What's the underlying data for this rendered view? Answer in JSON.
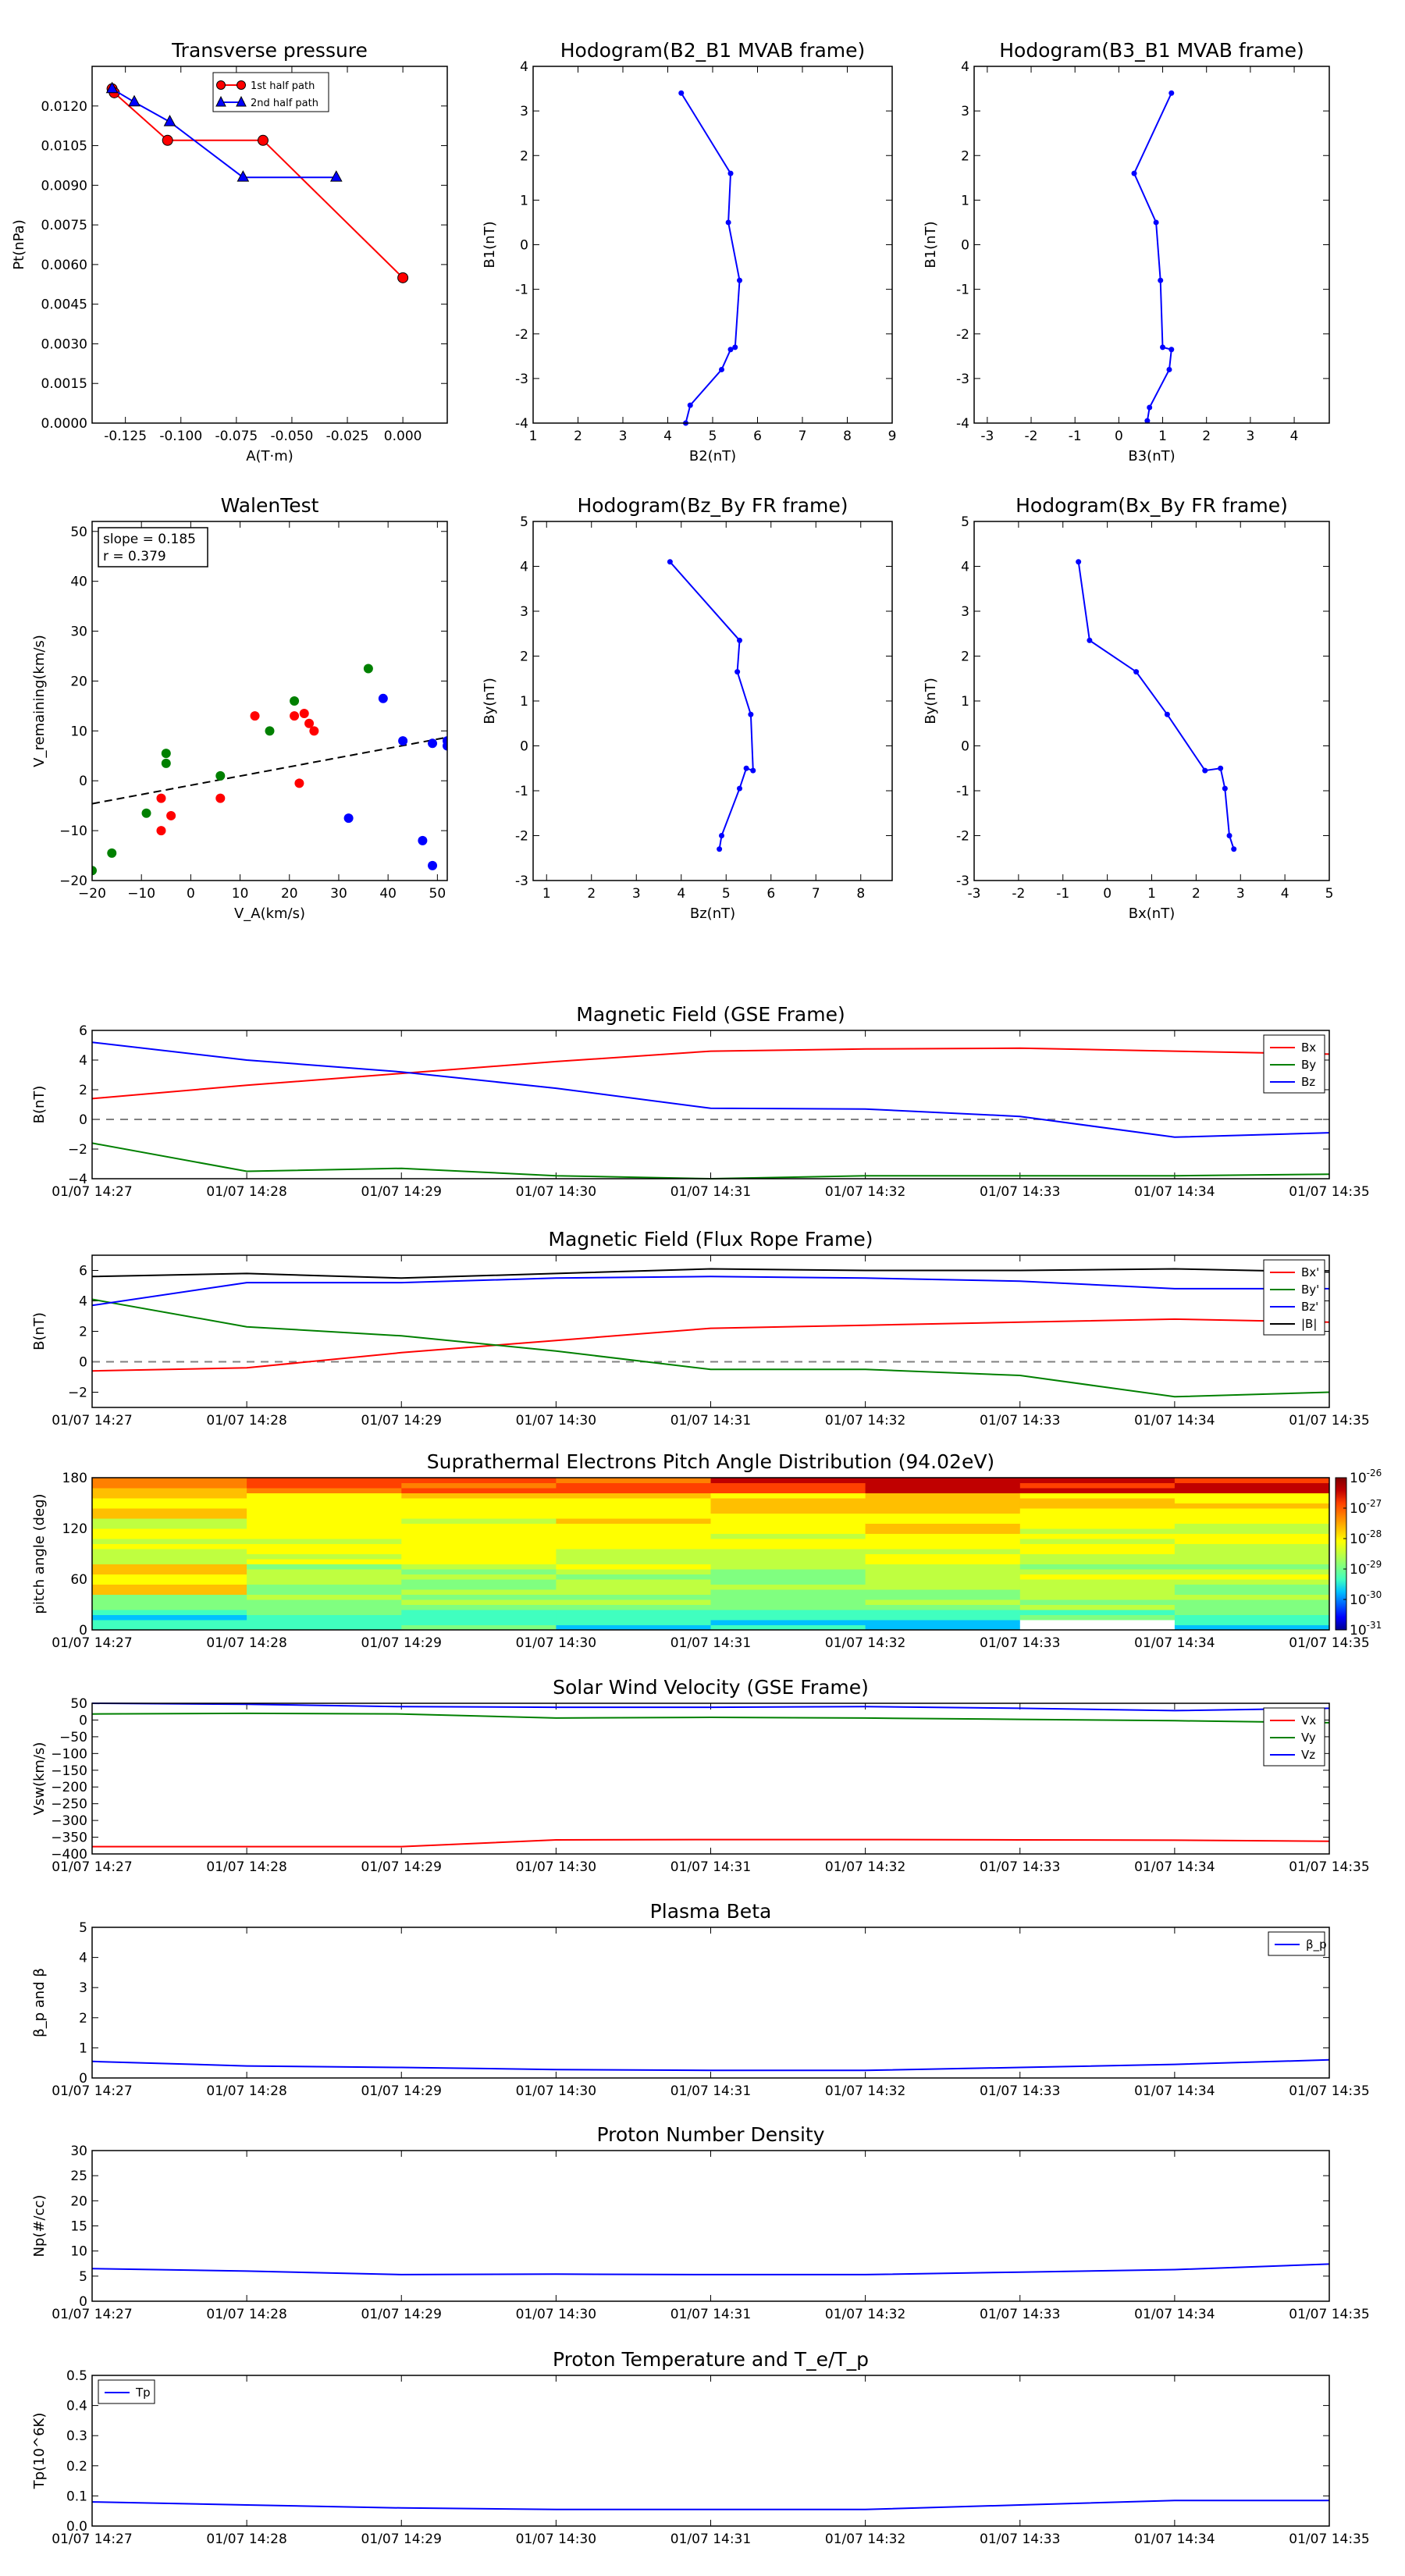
{
  "colors": {
    "red": "#ff0000",
    "green": "#008000",
    "blue": "#0000ff",
    "black": "#000000",
    "dash": "#808080"
  },
  "time_ticks": [
    "01/07 14:27",
    "01/07 14:28",
    "01/07 14:29",
    "01/07 14:30",
    "01/07 14:31",
    "01/07 14:32",
    "01/07 14:33",
    "01/07 14:34",
    "01/07 14:35"
  ],
  "colorbar_ticks": [
    "10",
    "10",
    "10",
    "10",
    "10",
    "10"
  ],
  "colorbar_exps": [
    "-26",
    "-27",
    "-28",
    "-29",
    "-30",
    "-31"
  ],
  "chart_data": [
    {
      "type": "line",
      "title": "Transverse pressure",
      "xlabel": "A(T·m)",
      "ylabel": "Pt(nPa)",
      "xlim": [
        -0.14,
        0.02
      ],
      "ylim": [
        0,
        0.0135
      ],
      "xticks": [
        "-0.125",
        "-0.100",
        "-0.075",
        "-0.050",
        "-0.025",
        "0.000"
      ],
      "xtick_vals": [
        -0.125,
        -0.1,
        -0.075,
        -0.05,
        -0.025,
        0.0
      ],
      "yticks": [
        "0.0000",
        "0.0015",
        "0.0030",
        "0.0045",
        "0.0060",
        "0.0075",
        "0.0090",
        "0.0105",
        "0.0120"
      ],
      "ytick_vals": [
        0,
        0.0015,
        0.003,
        0.0045,
        0.006,
        0.0075,
        0.009,
        0.0105,
        0.012
      ],
      "legend": "upper center",
      "series": [
        {
          "name": "1st half path",
          "color": "red",
          "marker": "circle",
          "x": [
            -0.131,
            -0.13,
            -0.106,
            -0.063,
            0.0
          ],
          "y": [
            0.01265,
            0.0125,
            0.0107,
            0.0107,
            0.0055
          ]
        },
        {
          "name": "2nd half path",
          "color": "blue",
          "marker": "triangle",
          "x": [
            -0.131,
            -0.121,
            -0.105,
            -0.072,
            -0.03
          ],
          "y": [
            0.01265,
            0.01215,
            0.0114,
            0.0093,
            0.0093
          ]
        }
      ]
    },
    {
      "type": "line",
      "title": "Hodogram(B2_B1 MVAB frame)",
      "xlabel": "B2(nT)",
      "ylabel": "B1(nT)",
      "xlim": [
        1,
        9
      ],
      "ylim": [
        -4,
        4
      ],
      "xticks": [
        "1",
        "2",
        "3",
        "4",
        "5",
        "6",
        "7",
        "8",
        "9"
      ],
      "xtick_vals": [
        1,
        2,
        3,
        4,
        5,
        6,
        7,
        8,
        9
      ],
      "yticks": [
        "-4",
        "-3",
        "-2",
        "-1",
        "0",
        "1",
        "2",
        "3",
        "4"
      ],
      "ytick_vals": [
        -4,
        -3,
        -2,
        -1,
        0,
        1,
        2,
        3,
        4
      ],
      "series": [
        {
          "color": "blue",
          "marker": "dot",
          "x": [
            4.3,
            5.4,
            5.35,
            5.6,
            5.5,
            5.4,
            5.2,
            4.5,
            4.4
          ],
          "y": [
            3.4,
            1.6,
            0.5,
            -0.8,
            -2.3,
            -2.35,
            -2.8,
            -3.6,
            -4.0
          ]
        }
      ]
    },
    {
      "type": "line",
      "title": "Hodogram(B3_B1 MVAB frame)",
      "xlabel": "B3(nT)",
      "ylabel": "B1(nT)",
      "xlim": [
        -3.3,
        4.8
      ],
      "ylim": [
        -4,
        4
      ],
      "xticks": [
        "-3",
        "-2",
        "-1",
        "0",
        "1",
        "2",
        "3",
        "4"
      ],
      "xtick_vals": [
        -3,
        -2,
        -1,
        0,
        1,
        2,
        3,
        4
      ],
      "yticks": [
        "-4",
        "-3",
        "-2",
        "-1",
        "0",
        "1",
        "2",
        "3",
        "4"
      ],
      "ytick_vals": [
        -4,
        -3,
        -2,
        -1,
        0,
        1,
        2,
        3,
        4
      ],
      "series": [
        {
          "color": "blue",
          "marker": "dot",
          "x": [
            1.2,
            0.35,
            0.85,
            0.95,
            1.0,
            1.2,
            1.15,
            0.7,
            0.65
          ],
          "y": [
            3.4,
            1.6,
            0.5,
            -0.8,
            -2.3,
            -2.35,
            -2.8,
            -3.65,
            -3.95
          ]
        }
      ]
    },
    {
      "type": "scatter",
      "title": "WalenTest",
      "xlabel": "V_A(km/s)",
      "ylabel": "V_remaining(km/s)",
      "xlim": [
        -20,
        52
      ],
      "ylim": [
        -20,
        52
      ],
      "xticks": [
        "−20",
        "−10",
        "0",
        "10",
        "20",
        "30",
        "40",
        "50"
      ],
      "xtick_vals": [
        -20,
        -10,
        0,
        10,
        20,
        30,
        40,
        50
      ],
      "yticks": [
        "−20",
        "−10",
        "0",
        "10",
        "20",
        "30",
        "40",
        "50"
      ],
      "ytick_vals": [
        -20,
        -10,
        0,
        10,
        20,
        30,
        40,
        50
      ],
      "annotation": [
        "slope = 0.185",
        "r = 0.379"
      ],
      "fit_line": {
        "slope": 0.185,
        "intercept": -0.9
      },
      "series": [
        {
          "color": "red",
          "x": [
            13,
            21,
            23,
            24,
            25,
            22,
            -6,
            -4,
            6,
            -6
          ],
          "y": [
            13,
            13,
            13.5,
            11.5,
            10,
            -0.5,
            -3.5,
            -7,
            -3.5,
            -10
          ]
        },
        {
          "color": "green",
          "x": [
            -5,
            -5,
            6,
            16,
            21,
            36,
            -9,
            -16,
            -20
          ],
          "y": [
            5.5,
            3.5,
            1,
            10,
            16,
            22.5,
            -6.5,
            -14.5,
            -18
          ]
        },
        {
          "color": "blue",
          "x": [
            39,
            43,
            49,
            52,
            52,
            32,
            47,
            49
          ],
          "y": [
            16.5,
            8,
            7.5,
            8,
            7,
            -7.5,
            -12,
            -17
          ]
        }
      ]
    },
    {
      "type": "line",
      "title": "Hodogram(Bz_By FR frame)",
      "xlabel": "Bz(nT)",
      "ylabel": "By(nT)",
      "xlim": [
        0.7,
        8.7
      ],
      "ylim": [
        -3,
        5
      ],
      "xticks": [
        "1",
        "2",
        "3",
        "4",
        "5",
        "6",
        "7",
        "8"
      ],
      "xtick_vals": [
        1,
        2,
        3,
        4,
        5,
        6,
        7,
        8
      ],
      "yticks": [
        "-3",
        "-2",
        "-1",
        "0",
        "1",
        "2",
        "3",
        "4",
        "5"
      ],
      "ytick_vals": [
        -3,
        -2,
        -1,
        0,
        1,
        2,
        3,
        4,
        5
      ],
      "series": [
        {
          "color": "blue",
          "marker": "dot",
          "x": [
            3.75,
            5.3,
            5.25,
            5.55,
            5.6,
            5.45,
            5.3,
            4.9,
            4.85
          ],
          "y": [
            4.1,
            2.35,
            1.65,
            0.7,
            -0.55,
            -0.5,
            -0.95,
            -2.0,
            -2.3
          ]
        }
      ]
    },
    {
      "type": "line",
      "title": "Hodogram(Bx_By FR frame)",
      "xlabel": "Bx(nT)",
      "ylabel": "By(nT)",
      "xlim": [
        -3,
        5
      ],
      "ylim": [
        -3,
        5
      ],
      "xticks": [
        "-3",
        "-2",
        "-1",
        "0",
        "1",
        "2",
        "3",
        "4",
        "5"
      ],
      "xtick_vals": [
        -3,
        -2,
        -1,
        0,
        1,
        2,
        3,
        4,
        5
      ],
      "yticks": [
        "-3",
        "-2",
        "-1",
        "0",
        "1",
        "2",
        "3",
        "4",
        "5"
      ],
      "ytick_vals": [
        -3,
        -2,
        -1,
        0,
        1,
        2,
        3,
        4,
        5
      ],
      "series": [
        {
          "color": "blue",
          "marker": "dot",
          "x": [
            -0.65,
            -0.4,
            0.65,
            1.35,
            2.2,
            2.55,
            2.65,
            2.75,
            2.85
          ],
          "y": [
            4.1,
            2.35,
            1.65,
            0.7,
            -0.55,
            -0.5,
            -0.95,
            -2.0,
            -2.3
          ]
        }
      ]
    },
    {
      "type": "line",
      "title": "Magnetic Field (GSE Frame)",
      "xlabel": "",
      "ylabel": "B(nT)",
      "ylim": [
        -4,
        6
      ],
      "yticks": [
        "−4",
        "−2",
        "0",
        "2",
        "4",
        "6"
      ],
      "ytick_vals": [
        -4,
        -2,
        0,
        2,
        4,
        6
      ],
      "zero_line": true,
      "legend": "upper right",
      "series": [
        {
          "name": "Bx",
          "color": "red",
          "values": [
            1.4,
            2.3,
            3.1,
            3.9,
            4.6,
            4.75,
            4.8,
            4.6,
            4.4
          ]
        },
        {
          "name": "By",
          "color": "green",
          "values": [
            -1.6,
            -3.5,
            -3.3,
            -3.8,
            -4.0,
            -3.8,
            -3.8,
            -3.8,
            -3.7
          ]
        },
        {
          "name": "Bz",
          "color": "blue",
          "values": [
            5.2,
            4.0,
            3.2,
            2.1,
            0.75,
            0.7,
            0.2,
            -1.2,
            -0.9
          ]
        }
      ]
    },
    {
      "type": "line",
      "title": "Magnetic Field (Flux Rope Frame)",
      "xlabel": "",
      "ylabel": "B(nT)",
      "ylim": [
        -3,
        7
      ],
      "yticks": [
        "−2",
        "0",
        "2",
        "4",
        "6"
      ],
      "ytick_vals": [
        -2,
        0,
        2,
        4,
        6
      ],
      "zero_line": true,
      "legend": "upper right",
      "series": [
        {
          "name": "Bx'",
          "color": "red",
          "values": [
            -0.6,
            -0.4,
            0.6,
            1.4,
            2.2,
            2.4,
            2.6,
            2.8,
            2.6
          ]
        },
        {
          "name": "By'",
          "color": "green",
          "values": [
            4.1,
            2.3,
            1.7,
            0.7,
            -0.5,
            -0.5,
            -0.9,
            -2.3,
            -2.0
          ]
        },
        {
          "name": "Bz'",
          "color": "blue",
          "values": [
            3.7,
            5.2,
            5.2,
            5.5,
            5.6,
            5.5,
            5.3,
            4.8,
            4.8
          ]
        },
        {
          "name": "|B|",
          "color": "black",
          "values": [
            5.6,
            5.8,
            5.5,
            5.8,
            6.1,
            6.0,
            6.0,
            6.1,
            5.9
          ]
        }
      ]
    },
    {
      "type": "heatmap",
      "title": "Suprathermal Electrons Pitch Angle Distribution (94.02eV)",
      "xlabel": "",
      "ylabel": "pitch angle (deg)",
      "ylim": [
        0,
        180
      ],
      "yticks": [
        "0",
        "60",
        "120",
        "180"
      ],
      "ytick_vals": [
        0,
        60,
        120,
        180
      ],
      "colorbar": "log, 1e-31 to 1e-26"
    },
    {
      "type": "line",
      "title": "Solar Wind Velocity (GSE Frame)",
      "xlabel": "",
      "ylabel": "Vsw(km/s)",
      "ylim": [
        -400,
        50
      ],
      "yticks": [
        "−400",
        "−350",
        "−300",
        "−250",
        "−200",
        "−150",
        "−100",
        "−50",
        "0",
        "50"
      ],
      "ytick_vals": [
        -400,
        -350,
        -300,
        -250,
        -200,
        -150,
        -100,
        -50,
        0,
        50
      ],
      "legend": "upper right",
      "series": [
        {
          "name": "Vx",
          "color": "red",
          "values": [
            -378,
            -378,
            -378,
            -358,
            -357,
            -357,
            -358,
            -359,
            -362
          ]
        },
        {
          "name": "Vy",
          "color": "green",
          "values": [
            18,
            20,
            18,
            6,
            8,
            6,
            2,
            -2,
            -8
          ]
        },
        {
          "name": "Vz",
          "color": "blue",
          "values": [
            50,
            47,
            40,
            38,
            38,
            40,
            35,
            28,
            35
          ]
        }
      ]
    },
    {
      "type": "line",
      "title": "Plasma Beta",
      "xlabel": "",
      "ylabel": "β_p and β",
      "ylim": [
        0,
        5
      ],
      "yticks": [
        "0",
        "1",
        "2",
        "3",
        "4",
        "5"
      ],
      "ytick_vals": [
        0,
        1,
        2,
        3,
        4,
        5
      ],
      "legend": "upper right",
      "series": [
        {
          "name": "β_p",
          "color": "blue",
          "values": [
            0.55,
            0.4,
            0.35,
            0.28,
            0.25,
            0.25,
            0.35,
            0.45,
            0.6
          ]
        }
      ]
    },
    {
      "type": "line",
      "title": "Proton Number Density",
      "xlabel": "",
      "ylabel": "Np(#/cc)",
      "ylim": [
        0,
        30
      ],
      "yticks": [
        "0",
        "5",
        "10",
        "15",
        "20",
        "25",
        "30"
      ],
      "ytick_vals": [
        0,
        5,
        10,
        15,
        20,
        25,
        30
      ],
      "series": [
        {
          "name": "Np",
          "color": "blue",
          "values": [
            6.5,
            6.0,
            5.3,
            5.4,
            5.3,
            5.3,
            5.8,
            6.3,
            7.4
          ]
        }
      ]
    },
    {
      "type": "line",
      "title": "Proton Temperature and T_e/T_p",
      "xlabel": "",
      "ylabel": "Tp(10^6K)",
      "ylim": [
        0,
        0.5
      ],
      "yticks": [
        "0.0",
        "0.1",
        "0.2",
        "0.3",
        "0.4",
        "0.5"
      ],
      "ytick_vals": [
        0,
        0.1,
        0.2,
        0.3,
        0.4,
        0.5
      ],
      "legend": "upper left",
      "series": [
        {
          "name": "Tp",
          "color": "blue",
          "values": [
            0.08,
            0.07,
            0.06,
            0.055,
            0.055,
            0.055,
            0.07,
            0.085,
            0.085
          ]
        }
      ]
    }
  ]
}
